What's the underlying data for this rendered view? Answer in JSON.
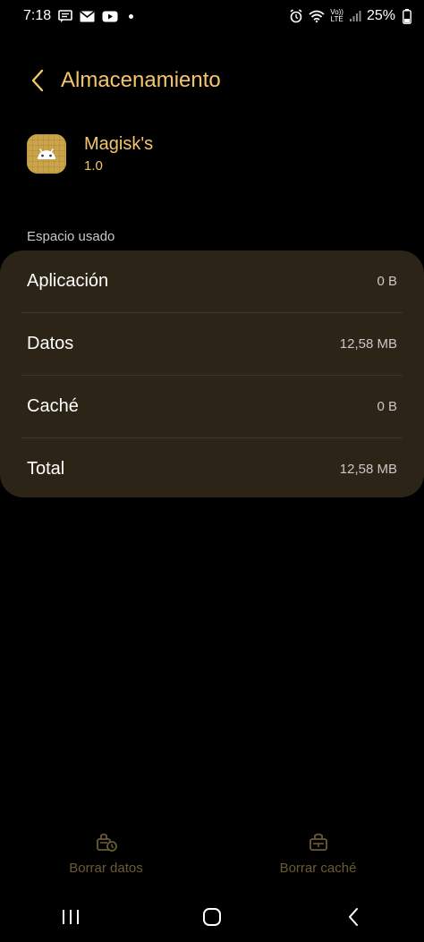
{
  "status_bar": {
    "time": "7:18",
    "battery_percent": "25%",
    "network_label_top": "Vo))",
    "network_label_bottom": "LTE",
    "icons": [
      "message-icon",
      "gmail-icon",
      "youtube-icon",
      "alarm-icon",
      "wifi-icon",
      "signal-icon",
      "battery-icon"
    ]
  },
  "header": {
    "title": "Almacenamiento"
  },
  "app": {
    "name": "Magisk's",
    "version": "1.0",
    "icon": "android-icon"
  },
  "storage": {
    "section_label": "Espacio usado",
    "rows": [
      {
        "label": "Aplicación",
        "value": "0 B"
      },
      {
        "label": "Datos",
        "value": "12,58 MB"
      },
      {
        "label": "Caché",
        "value": "0 B"
      },
      {
        "label": "Total",
        "value": "12,58 MB"
      }
    ]
  },
  "actions": {
    "clear_data_label": "Borrar datos",
    "clear_cache_label": "Borrar caché"
  },
  "colors": {
    "accent": "#f5c56b",
    "card_bg": "#2b2417",
    "disabled_action": "#6c5a35"
  }
}
